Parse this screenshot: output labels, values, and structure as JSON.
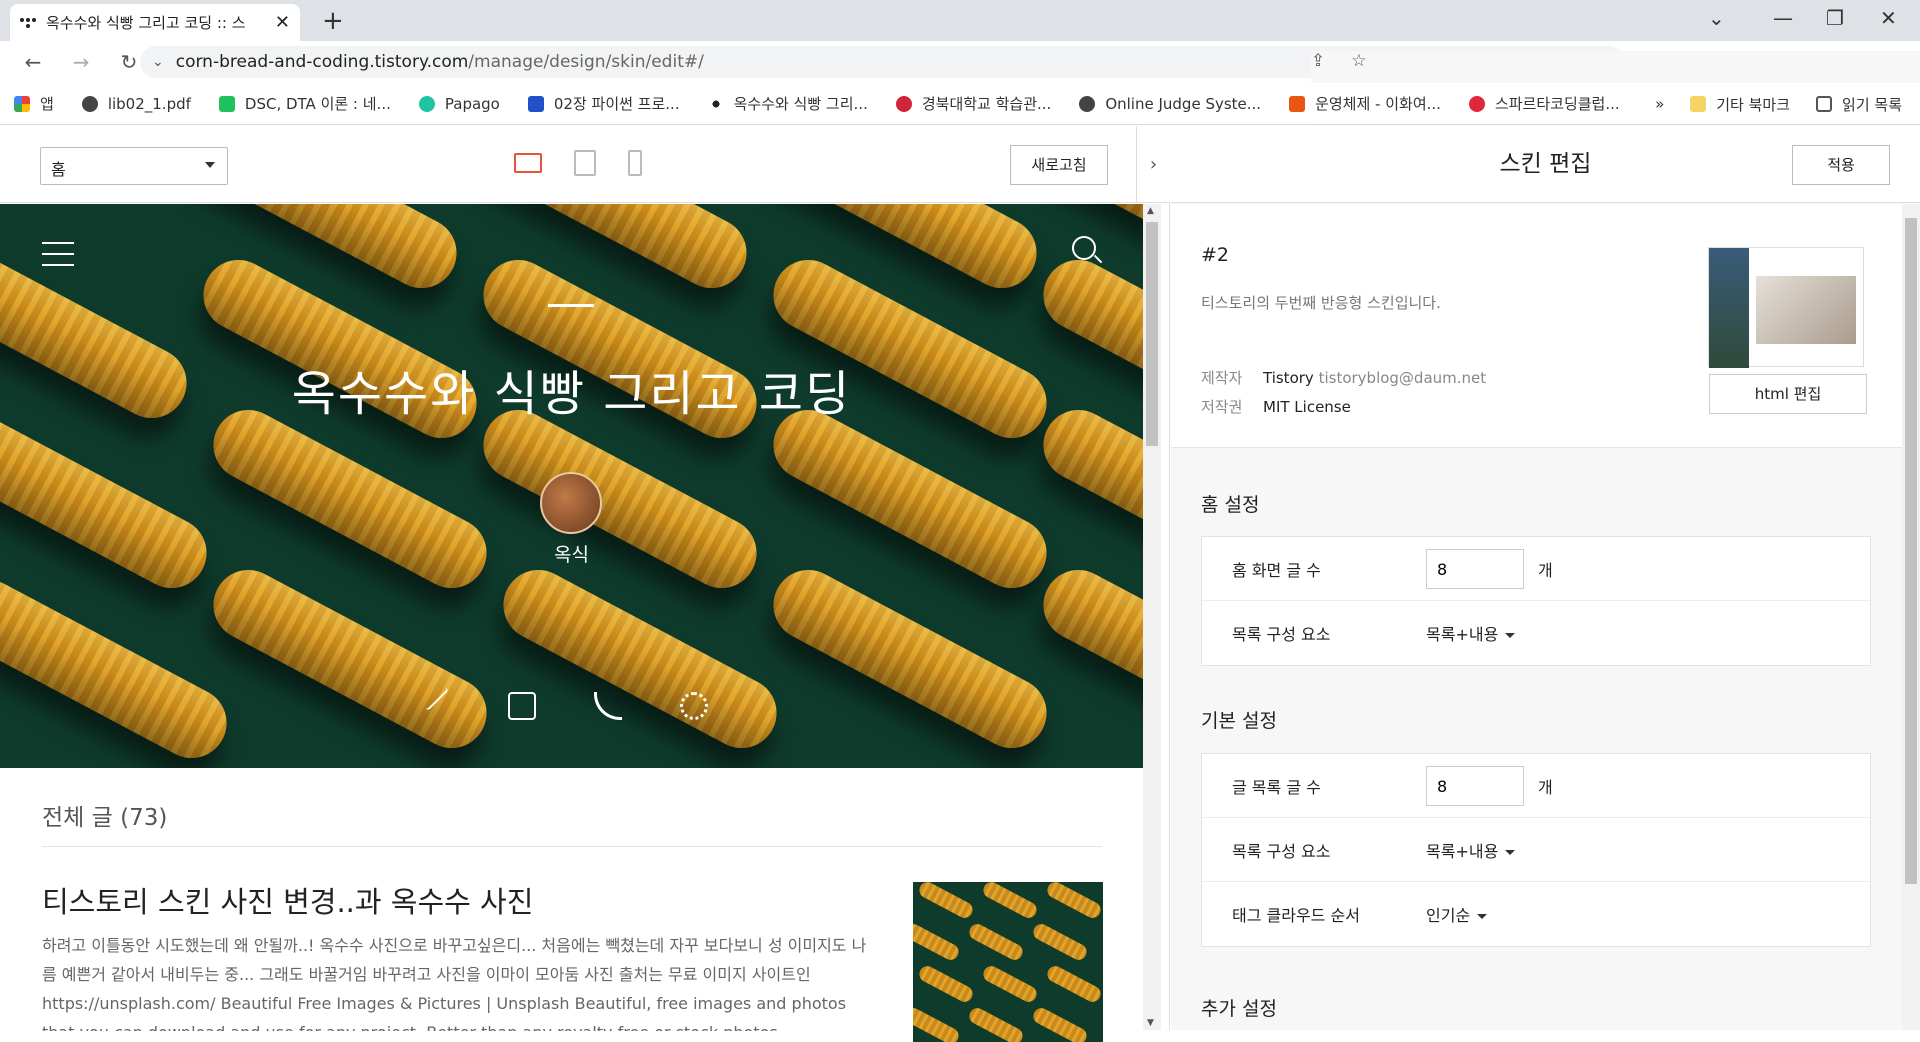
{
  "browser": {
    "tab_title": "옥수수와 식빵 그리고 코딩 :: 스",
    "url_host": "corn-bread-and-coding.tistory.com",
    "url_path": "/manage/design/skin/edit#/",
    "bookmarks": [
      {
        "label": "앱",
        "icon": "apps-icon",
        "color": "#ea4335"
      },
      {
        "label": "lib02_1.pdf",
        "icon": "globe-icon",
        "color": "#444"
      },
      {
        "label": "DSC, DTA 이론 : 네...",
        "icon": "blog-icon",
        "color": "#21c25e"
      },
      {
        "label": "Papago",
        "icon": "papago-icon",
        "color": "#1dc5a0"
      },
      {
        "label": "02장 파이썬 프로...",
        "icon": "book-icon",
        "color": "#2450c8"
      },
      {
        "label": "옥수수와 식빵 그리...",
        "icon": "tistory-icon",
        "color": "#222"
      },
      {
        "label": "경북대학교 학습관...",
        "icon": "knu-icon",
        "color": "#d0263a"
      },
      {
        "label": "Online Judge Syste...",
        "icon": "globe-icon",
        "color": "#444"
      },
      {
        "label": "운영체제 - 이화여...",
        "icon": "k-icon",
        "color": "#e9560f"
      },
      {
        "label": "스파르타코딩클럽...",
        "icon": "heart-icon",
        "color": "#e0283c"
      }
    ],
    "overflow": "»",
    "folder": "기타 북마크",
    "reading_list": "읽기 목록"
  },
  "preview": {
    "page_select": "홈",
    "refresh": "새로고침",
    "blog_title": "옥수수와 식빵 그리고 코딩",
    "nickname": "옥식",
    "all_posts": "전체 글 (73)",
    "post_title": "티스토리 스킨 사진 변경..과 옥수수 사진",
    "post_body": "하려고 이틀동안 시도했는데 왜 안될까..! 옥수수 사진으로 바꾸고싶은디... 처음에는 빽쳤는데 자꾸 보다보니 성 이미지도 나름 예쁜거 같아서 내비두는 중... 그래도 바꿀거임 바꾸려고 사진을 이마이 모아둠 사진 출처는 무료 이미지 사이트인 https://unsplash.com/ Beautiful Free Images & Pictures | Unsplash Beautiful, free images and photos that you can download and use for any project. Better than any royalty free or stock photos. unsplash.com"
  },
  "editor": {
    "title": "스킨 편집",
    "apply": "적용",
    "skin_number": "#2",
    "skin_desc": "티스토리의 두번째 반응형 스킨입니다.",
    "author_key": "제작자",
    "author_name": "Tistory",
    "author_email": "tistoryblog@daum.net",
    "license_key": "저작권",
    "license": "MIT License",
    "html_edit": "html 편집",
    "home_section": "홈 설정",
    "home_post_count_label": "홈 화면 글 수",
    "home_post_count": "8",
    "unit": "개",
    "home_list_label": "목록 구성 요소",
    "home_list_value": "목록+내용",
    "basic_section": "기본 설정",
    "list_count_label": "글 목록 글 수",
    "list_count": "8",
    "basic_list_label": "목록 구성 요소",
    "basic_list_value": "목록+내용",
    "tag_order_label": "태그 클라우드 순서",
    "tag_order_value": "인기순",
    "extra_section": "추가 설정"
  }
}
